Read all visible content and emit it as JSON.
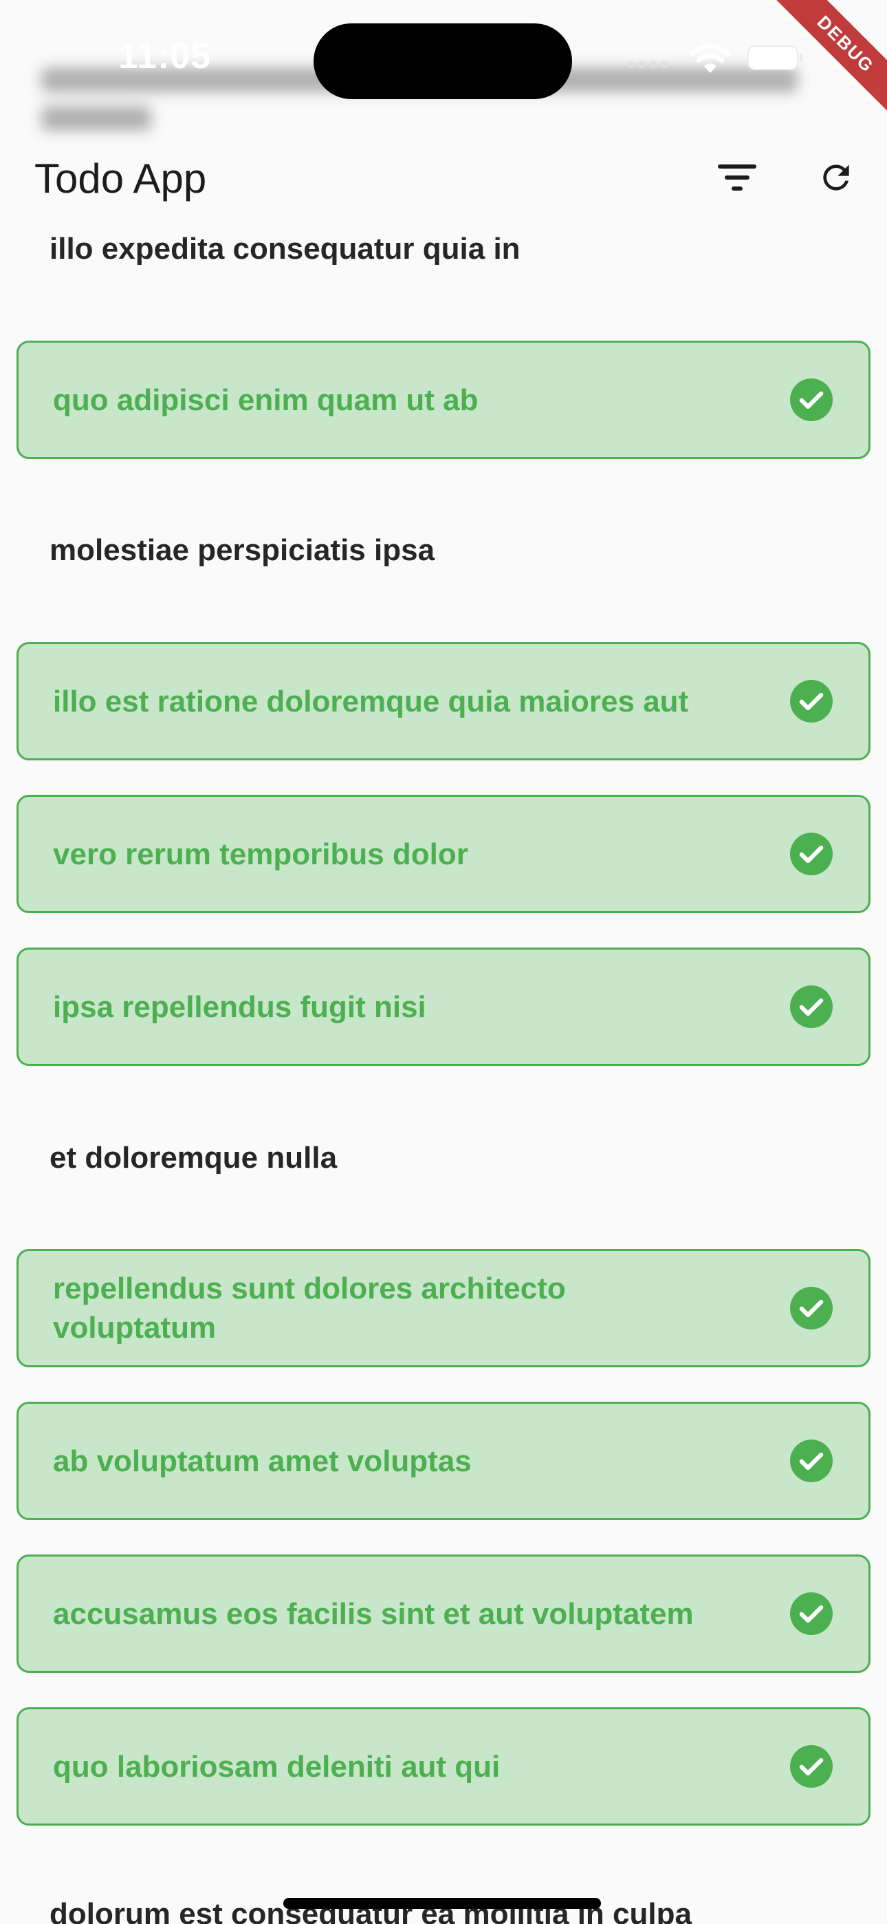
{
  "status_bar": {
    "time": "11:05"
  },
  "app_bar": {
    "title": "Todo App",
    "filter_icon": "filter-icon",
    "refresh_icon": "refresh-icon"
  },
  "debug_banner": "DEBUG",
  "list": {
    "headers": [
      "illo expedita consequatur quia in",
      "molestiae perspiciatis ipsa",
      "et doloremque nulla",
      "dolorum est consequatur ea mollitia in culpa"
    ],
    "todos": [
      {
        "title": "quo adipisci enim quam ut ab",
        "completed": true
      },
      {
        "title": "illo est ratione doloremque quia maiores aut",
        "completed": true
      },
      {
        "title": "vero rerum temporibus dolor",
        "completed": true
      },
      {
        "title": "ipsa repellendus fugit nisi",
        "completed": true
      },
      {
        "title": "repellendus sunt dolores architecto voluptatum",
        "completed": true
      },
      {
        "title": "ab voluptatum amet voluptas",
        "completed": true
      },
      {
        "title": "accusamus eos facilis sint et aut voluptatem",
        "completed": true
      },
      {
        "title": "quo laboriosam deleniti aut qui",
        "completed": true
      }
    ]
  },
  "colors": {
    "card_background": "#c8e6c9",
    "card_border": "#4caf50",
    "completed_text": "#4caf50",
    "header_text": "#262626",
    "debug": "#b71c1c"
  }
}
